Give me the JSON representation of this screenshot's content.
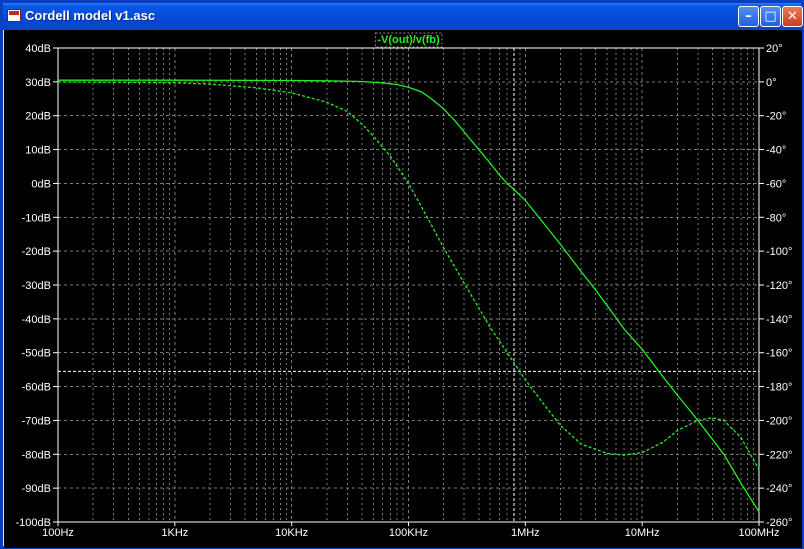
{
  "window": {
    "title": "Cordell model v1.asc",
    "minimize_glyph": "–",
    "maximize_glyph": "□",
    "close_glyph": "✕"
  },
  "colors": {
    "background": "#000000",
    "trace": "#22ee22",
    "grid": "#7a7a7a",
    "cursor": "#ffffff",
    "titlebar": "#0a58e6"
  },
  "chart_data": {
    "type": "line",
    "legend": "-V(out)/v(fb)",
    "x_scale": "log",
    "xlim": [
      100,
      100000000
    ],
    "x_ticks": [
      {
        "value": 100,
        "label": "100Hz"
      },
      {
        "value": 1000,
        "label": "1KHz"
      },
      {
        "value": 10000,
        "label": "10KHz"
      },
      {
        "value": 100000,
        "label": "100KHz"
      },
      {
        "value": 1000000,
        "label": "1MHz"
      },
      {
        "value": 10000000,
        "label": "10MHz"
      },
      {
        "value": 100000000,
        "label": "100MHz"
      }
    ],
    "y_left": {
      "unit": "dB",
      "ylim": [
        -100,
        40
      ],
      "ticks": [
        {
          "value": 40,
          "label": "40dB"
        },
        {
          "value": 30,
          "label": "30dB"
        },
        {
          "value": 20,
          "label": "20dB"
        },
        {
          "value": 10,
          "label": "10dB"
        },
        {
          "value": 0,
          "label": "0dB"
        },
        {
          "value": -10,
          "label": "-10dB"
        },
        {
          "value": -20,
          "label": "-20dB"
        },
        {
          "value": -30,
          "label": "-30dB"
        },
        {
          "value": -40,
          "label": "-40dB"
        },
        {
          "value": -50,
          "label": "-50dB"
        },
        {
          "value": -60,
          "label": "-60dB"
        },
        {
          "value": -70,
          "label": "-70dB"
        },
        {
          "value": -80,
          "label": "-80dB"
        },
        {
          "value": -90,
          "label": "-90dB"
        },
        {
          "value": -100,
          "label": "-100dB"
        }
      ]
    },
    "y_right": {
      "unit": "deg",
      "ylim": [
        -260,
        20
      ],
      "ticks": [
        {
          "value": 20,
          "label": "20°"
        },
        {
          "value": 0,
          "label": "0°"
        },
        {
          "value": -20,
          "label": "-20°"
        },
        {
          "value": -40,
          "label": "-40°"
        },
        {
          "value": -60,
          "label": "-60°"
        },
        {
          "value": -80,
          "label": "-80°"
        },
        {
          "value": -100,
          "label": "-100°"
        },
        {
          "value": -120,
          "label": "-120°"
        },
        {
          "value": -140,
          "label": "-140°"
        },
        {
          "value": -160,
          "label": "-160°"
        },
        {
          "value": -180,
          "label": "-180°"
        },
        {
          "value": -200,
          "label": "-200°"
        },
        {
          "value": -220,
          "label": "-220°"
        },
        {
          "value": -240,
          "label": "-240°"
        },
        {
          "value": -260,
          "label": "-260°"
        }
      ]
    },
    "grid": true,
    "series": [
      {
        "name": "magnitude",
        "axis": "left",
        "style": "solid",
        "points": [
          [
            100,
            30.5
          ],
          [
            1000,
            30.5
          ],
          [
            10000,
            30.4
          ],
          [
            20000,
            30.3
          ],
          [
            40000,
            30.1
          ],
          [
            60000,
            29.7
          ],
          [
            80000,
            29.2
          ],
          [
            100000,
            28.4
          ],
          [
            130000,
            27.0
          ],
          [
            160000,
            24.8
          ],
          [
            200000,
            22.0
          ],
          [
            250000,
            18.5
          ],
          [
            320000,
            14.0
          ],
          [
            400000,
            10.0
          ],
          [
            500000,
            6.0
          ],
          [
            600000,
            2.5
          ],
          [
            700000,
            0.0
          ],
          [
            800000,
            -1.8
          ],
          [
            1000000,
            -5.0
          ],
          [
            2000000,
            -18.0
          ],
          [
            3000000,
            -26.0
          ],
          [
            4000000,
            -31.5
          ],
          [
            5000000,
            -36.0
          ],
          [
            7000000,
            -43.0
          ],
          [
            10000000,
            -49.0
          ],
          [
            15000000,
            -57.0
          ],
          [
            20000000,
            -62.5
          ],
          [
            30000000,
            -70.0
          ],
          [
            50000000,
            -80.0
          ],
          [
            70000000,
            -88.5
          ],
          [
            100000000,
            -97.0
          ]
        ]
      },
      {
        "name": "phase",
        "axis": "right",
        "style": "dashed",
        "points": [
          [
            100,
            0.0
          ],
          [
            1000,
            -0.5
          ],
          [
            2000,
            -1.3
          ],
          [
            5000,
            -3.5
          ],
          [
            10000,
            -6.5
          ],
          [
            20000,
            -12.0
          ],
          [
            30000,
            -17.5
          ],
          [
            40000,
            -25.0
          ],
          [
            50000,
            -32.0
          ],
          [
            70000,
            -44.0
          ],
          [
            100000,
            -60.0
          ],
          [
            150000,
            -82.0
          ],
          [
            200000,
            -98.0
          ],
          [
            300000,
            -119.0
          ],
          [
            500000,
            -145.0
          ],
          [
            700000,
            -160.0
          ],
          [
            1000000,
            -176.0
          ],
          [
            1500000,
            -192.0
          ],
          [
            2000000,
            -203.0
          ],
          [
            3000000,
            -214.0
          ],
          [
            5000000,
            -219.5
          ],
          [
            7000000,
            -220.5
          ],
          [
            10000000,
            -219.0
          ],
          [
            15000000,
            -213.0
          ],
          [
            20000000,
            -206.0
          ],
          [
            30000000,
            -200.0
          ],
          [
            40000000,
            -198.5
          ],
          [
            50000000,
            -200.0
          ],
          [
            70000000,
            -210.0
          ],
          [
            100000000,
            -229.0
          ]
        ]
      }
    ],
    "cursor": {
      "x": 800000,
      "y_dB": -55.5
    }
  }
}
